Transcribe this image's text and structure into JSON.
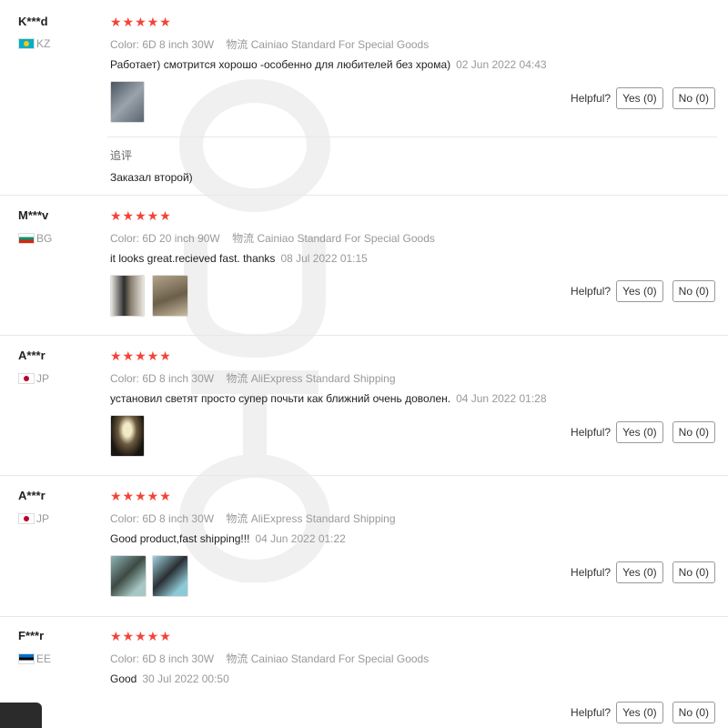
{
  "reviews": [
    {
      "user": "K***d",
      "country": "KZ",
      "stars": "★★★★★",
      "color_label": "Color:",
      "color_value": "6D 8 inch 30W",
      "shipping_label": "物流",
      "shipping_value": "Cainiao Standard For Special Goods",
      "text": "Работает) смотрится хорошо -особенно для любителей без хрома)",
      "date": "02 Jun 2022 04:43",
      "followup_label": "追评",
      "followup_text": "Заказал второй)",
      "helpful_label": "Helpful?",
      "yes": "Yes (0)",
      "no": "No (0)"
    },
    {
      "user": "M***v",
      "country": "BG",
      "stars": "★★★★★",
      "color_label": "Color:",
      "color_value": "6D 20 inch 90W",
      "shipping_label": "物流",
      "shipping_value": "Cainiao Standard For Special Goods",
      "text": "it looks great.recieved fast. thanks",
      "date": "08 Jul 2022 01:15",
      "helpful_label": "Helpful?",
      "yes": "Yes (0)",
      "no": "No (0)"
    },
    {
      "user": "A***r",
      "country": "JP",
      "stars": "★★★★★",
      "color_label": "Color:",
      "color_value": "6D 8 inch 30W",
      "shipping_label": "物流",
      "shipping_value": "AliExpress Standard Shipping",
      "text": "установил светят просто супер почьти как ближний очень доволен.",
      "date": "04 Jun 2022 01:28",
      "helpful_label": "Helpful?",
      "yes": "Yes (0)",
      "no": "No (0)"
    },
    {
      "user": "A***r",
      "country": "JP",
      "stars": "★★★★★",
      "color_label": "Color:",
      "color_value": "6D 8 inch 30W",
      "shipping_label": "物流",
      "shipping_value": "AliExpress Standard Shipping",
      "text": "Good product,fast shipping!!!",
      "date": "04 Jun 2022 01:22",
      "helpful_label": "Helpful?",
      "yes": "Yes (0)",
      "no": "No (0)"
    },
    {
      "user": "F***r",
      "country": "EE",
      "stars": "★★★★★",
      "color_label": "Color:",
      "color_value": "6D 8 inch 30W",
      "shipping_label": "物流",
      "shipping_value": "Cainiao Standard For Special Goods",
      "text": "Good",
      "date": "30 Jul 2022 00:50",
      "helpful_label": "Helpful?",
      "yes": "Yes (0)",
      "no": "No (0)"
    }
  ],
  "flag_colors": {
    "KZ": [
      "#00afca",
      "#fec50c"
    ],
    "BG": [
      "#ffffff",
      "#00966e",
      "#d62612"
    ],
    "JP": [
      "#ffffff",
      "#bc002d"
    ],
    "EE": [
      "#0072ce",
      "#000000",
      "#ffffff"
    ]
  },
  "star_color": "#f44336",
  "watermark": "OUTO"
}
